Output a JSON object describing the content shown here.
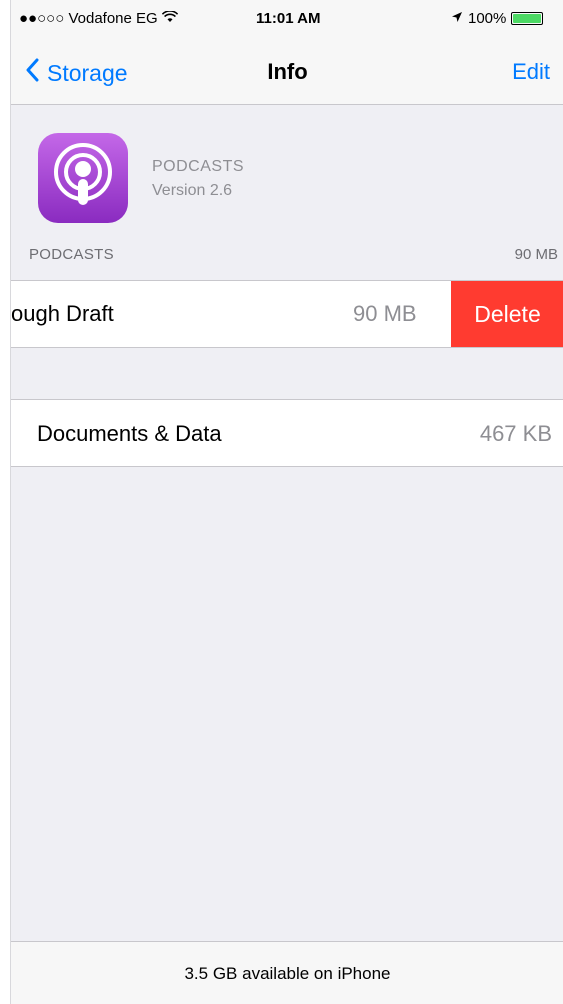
{
  "status_bar": {
    "carrier": "●●○○○ Vodafone EG",
    "wifi_icon": "wifi-icon",
    "time": "11:01 AM",
    "location_icon": "location-arrow-icon",
    "battery": "100%",
    "battery_color": "#4cd964"
  },
  "nav": {
    "back_label": "Storage",
    "title": "Info",
    "edit_label": "Edit",
    "accent": "#007aff"
  },
  "app": {
    "name": "PODCASTS",
    "version": "Version 2.6",
    "icon": "podcasts-app-icon"
  },
  "section": {
    "header": "PODCASTS",
    "size": "90 MB"
  },
  "podcast_row": {
    "title": "ough Draft",
    "size": "90 MB",
    "delete_label": "Delete",
    "delete_color": "#ff3b30"
  },
  "docs_row": {
    "title": "Documents & Data",
    "size": "467 KB"
  },
  "footer": {
    "text": "3.5 GB available on iPhone"
  }
}
